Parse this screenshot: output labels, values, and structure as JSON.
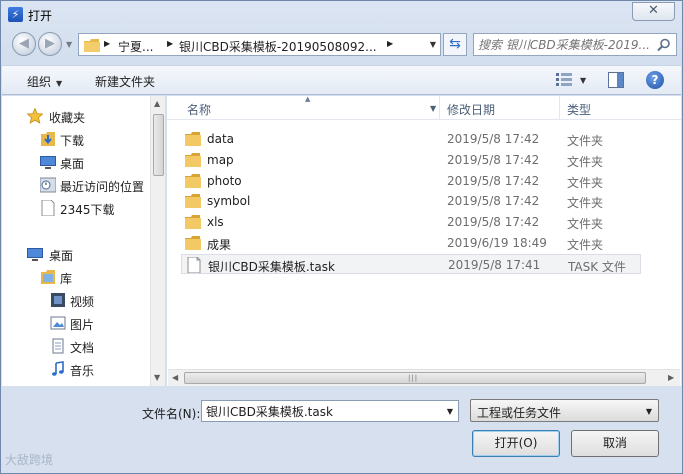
{
  "window": {
    "title": "打开",
    "close_label": "✕"
  },
  "address_bar": {
    "crumbs": [
      "宁夏...",
      "银川CBD采集模板-20190508092..."
    ]
  },
  "search": {
    "placeholder": "搜索 银川CBD采集模板-2019..."
  },
  "toolbar": {
    "organize_label": "组织",
    "new_folder_label": "新建文件夹"
  },
  "nav_pane": {
    "favorites_header": "收藏夹",
    "favorites": [
      "下载",
      "桌面",
      "最近访问的位置",
      "2345下载"
    ],
    "desktop_header": "桌面",
    "library_header": "库",
    "libraries": [
      "视频",
      "图片",
      "文档",
      "音乐"
    ]
  },
  "file_list": {
    "columns": {
      "name": "名称",
      "date": "修改日期",
      "type": "类型"
    },
    "rows": [
      {
        "name": "data",
        "date": "2019/5/8 17:42",
        "type": "文件夹",
        "icon": "folder-icon"
      },
      {
        "name": "map",
        "date": "2019/5/8 17:42",
        "type": "文件夹",
        "icon": "folder-icon"
      },
      {
        "name": "photo",
        "date": "2019/5/8 17:42",
        "type": "文件夹",
        "icon": "folder-icon"
      },
      {
        "name": "symbol",
        "date": "2019/5/8 17:42",
        "type": "文件夹",
        "icon": "folder-icon"
      },
      {
        "name": "xls",
        "date": "2019/5/8 17:42",
        "type": "文件夹",
        "icon": "folder-icon"
      },
      {
        "name": "成果",
        "date": "2019/6/19 18:49",
        "type": "文件夹",
        "icon": "folder-icon"
      },
      {
        "name": "银川CBD采集模板.task",
        "date": "2019/5/8 17:41",
        "type": "TASK 文件",
        "icon": "file-icon"
      }
    ]
  },
  "footer": {
    "filename_label": "文件名(N):",
    "filename_value": "银川CBD采集模板.task",
    "filetype_value": "工程或任务文件",
    "open_label": "打开(O)",
    "cancel_label": "取消"
  },
  "watermark": "大敌跨境",
  "colors": {
    "accent": "#2f6fc9",
    "folder": "#e8b84a",
    "frame": "#d6e0ef"
  }
}
